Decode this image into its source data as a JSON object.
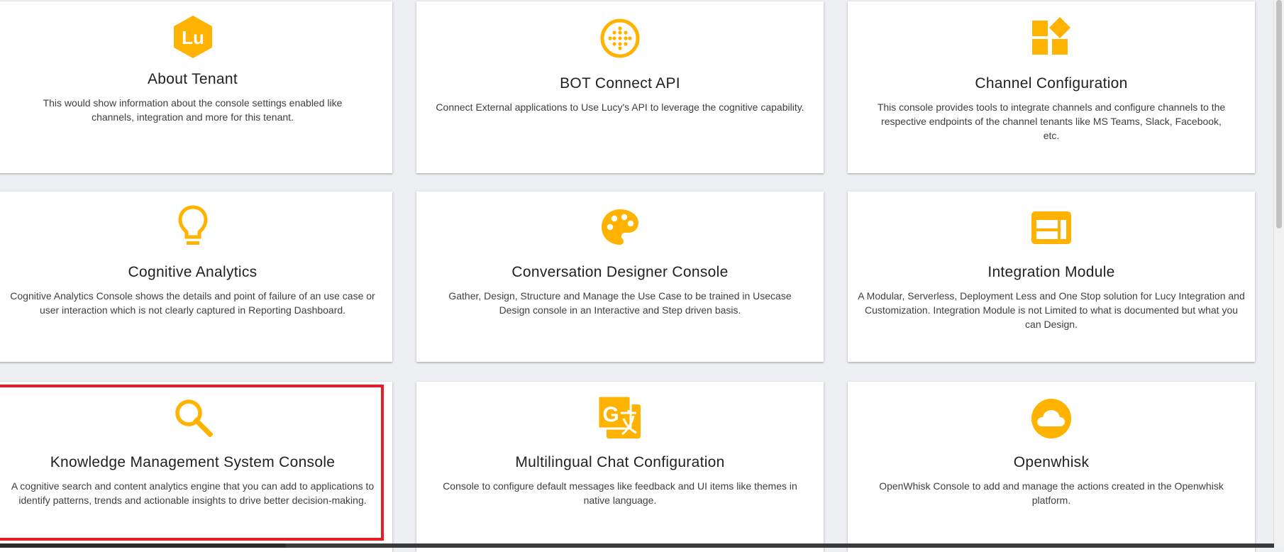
{
  "cards": [
    {
      "title": "About Tenant",
      "desc": "This would show information about the console settings enabled like channels, integration and more for this tenant.",
      "icon": "lu-hexagon-logo-icon"
    },
    {
      "title": "BOT Connect API",
      "desc": "Connect External applications to Use Lucy's API to leverage the cognitive capability.",
      "icon": "dotted-circle-icon"
    },
    {
      "title": "Channel Configuration",
      "desc": "This console provides tools to integrate channels and configure channels to the respective endpoints of the channel tenants like MS Teams, Slack, Facebook, etc.",
      "icon": "widgets-icon"
    },
    {
      "title": "Cognitive Analytics",
      "desc": "Cognitive Analytics Console shows the details and point of failure of an use case or user interaction which is not clearly captured in Reporting Dashboard.",
      "icon": "lightbulb-icon"
    },
    {
      "title": "Conversation Designer Console",
      "desc": "Gather, Design, Structure and Manage the Use Case to be trained in Usecase Design console in an Interactive and Step driven basis.",
      "icon": "palette-icon"
    },
    {
      "title": "Integration Module",
      "desc": "A Modular, Serverless, Deployment Less and One Stop solution for Lucy Integration and Customization. Integration Module is not Limited to what is documented but what you can Design.",
      "icon": "web-layout-icon"
    },
    {
      "title": "Knowledge Management System Console",
      "desc": "A cognitive search and content analytics engine that you can add to applications to identify patterns, trends and actionable insights to drive better decision-making.",
      "icon": "search-icon"
    },
    {
      "title": "Multilingual Chat Configuration",
      "desc": "Console to configure default messages like feedback and UI items like themes in native language.",
      "icon": "translate-icon"
    },
    {
      "title": "Openwhisk",
      "desc": "OpenWhisk Console to add and manage the actions created in the Openwhisk platform.",
      "icon": "cloud-icon"
    }
  ],
  "logo_text": "Lu",
  "translate_glyph": "G",
  "colors": {
    "accent": "#ffb300",
    "highlight": "#e3202a",
    "background": "#edeff2"
  }
}
